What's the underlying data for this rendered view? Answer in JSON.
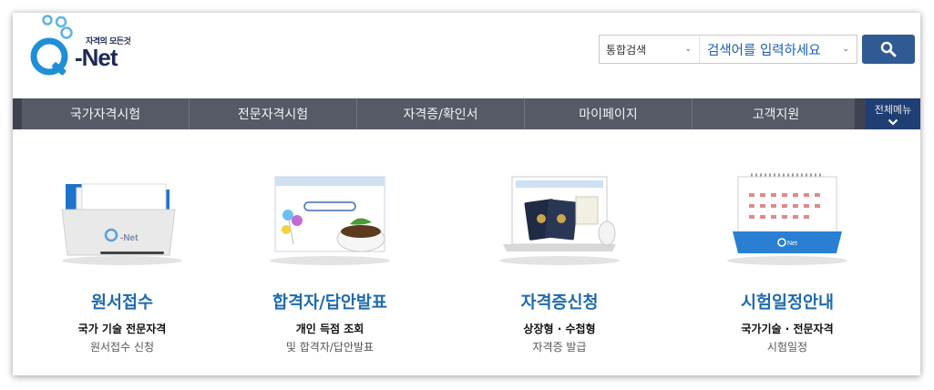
{
  "header": {
    "logo_tagline": "자격의 모든것",
    "logo_text": "-Net",
    "search": {
      "scope_label": "통합검색",
      "placeholder": "검색어를 입력하세요"
    }
  },
  "nav": {
    "items": [
      {
        "label": "국가자격시험"
      },
      {
        "label": "전문자격시험"
      },
      {
        "label": "자격증/확인서"
      },
      {
        "label": "마이페이지"
      },
      {
        "label": "고객지원"
      }
    ],
    "all_menu_label": "전체메뉴"
  },
  "services": [
    {
      "title": "원서접수",
      "line1": "국가 기술 전문자격",
      "line2": "원서접수 신청"
    },
    {
      "title": "합격자/답안발표",
      "line1": "개인 득점 조회",
      "line2": "및 합격자/답안발표"
    },
    {
      "title": "자격증신청",
      "line1": "상장형 · 수첩형",
      "line2": "자격증 발급"
    },
    {
      "title": "시험일정안내",
      "line1": "국가기술 · 전문자격",
      "line2": "시험일정"
    }
  ],
  "colors": {
    "brand_navy": "#1d2a55",
    "accent_blue": "#1f6aac",
    "nav_bg": "#555a66",
    "search_button": "#2f5a93"
  }
}
